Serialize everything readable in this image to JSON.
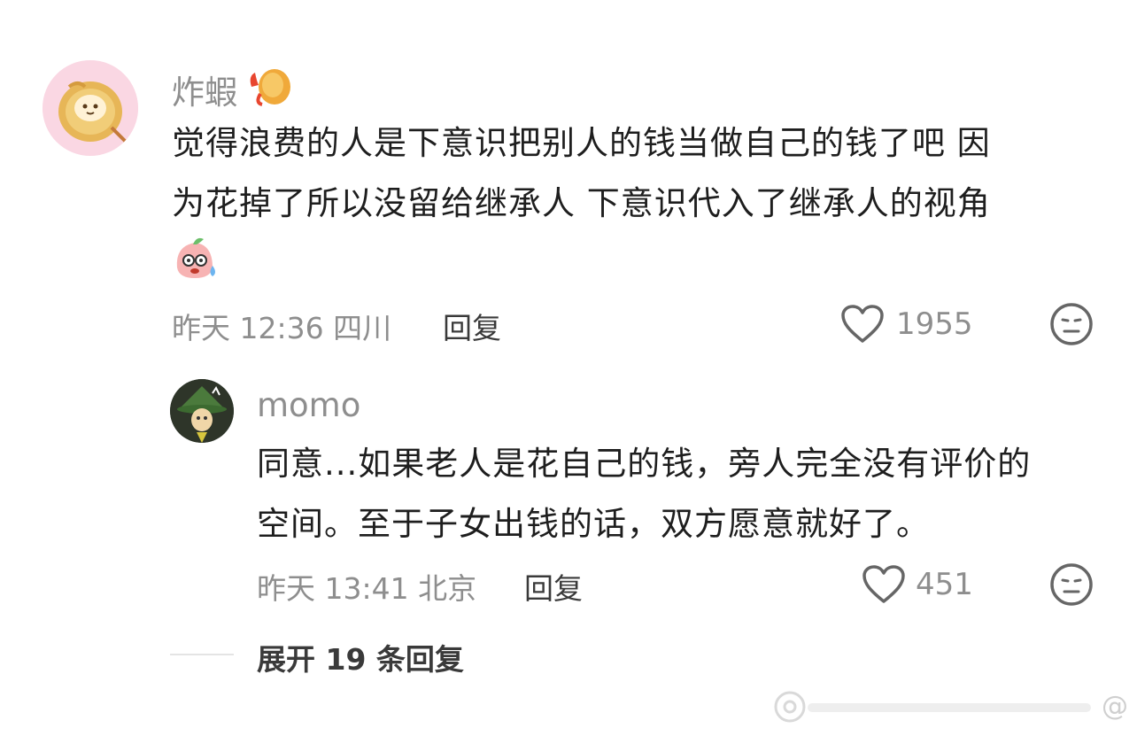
{
  "comment": {
    "author": "炸蝦",
    "text_line1": "觉得浪费的人是下意识把别人的钱当做自己的钱了吧 因",
    "text_line2": "为花掉了所以没留给继承人 下意识代入了继承人的视角",
    "meta": "昨天 12:36 四川",
    "reply_label": "回复",
    "like_count": "1955"
  },
  "reply": {
    "author": "momo",
    "text_line1": "同意...如果老人是花自己的钱，旁人完全没有评价的",
    "text_line2": "空间。至于子女出钱的话，双方愿意就好了。",
    "meta": "昨天 13:41 北京",
    "reply_label": "回复",
    "like_count": "451"
  },
  "expand_replies": "展开 19 条回复",
  "watermark": "@",
  "colors": {
    "secondary_text": "#8e8e8e",
    "primary_text": "#1e1e1e"
  }
}
